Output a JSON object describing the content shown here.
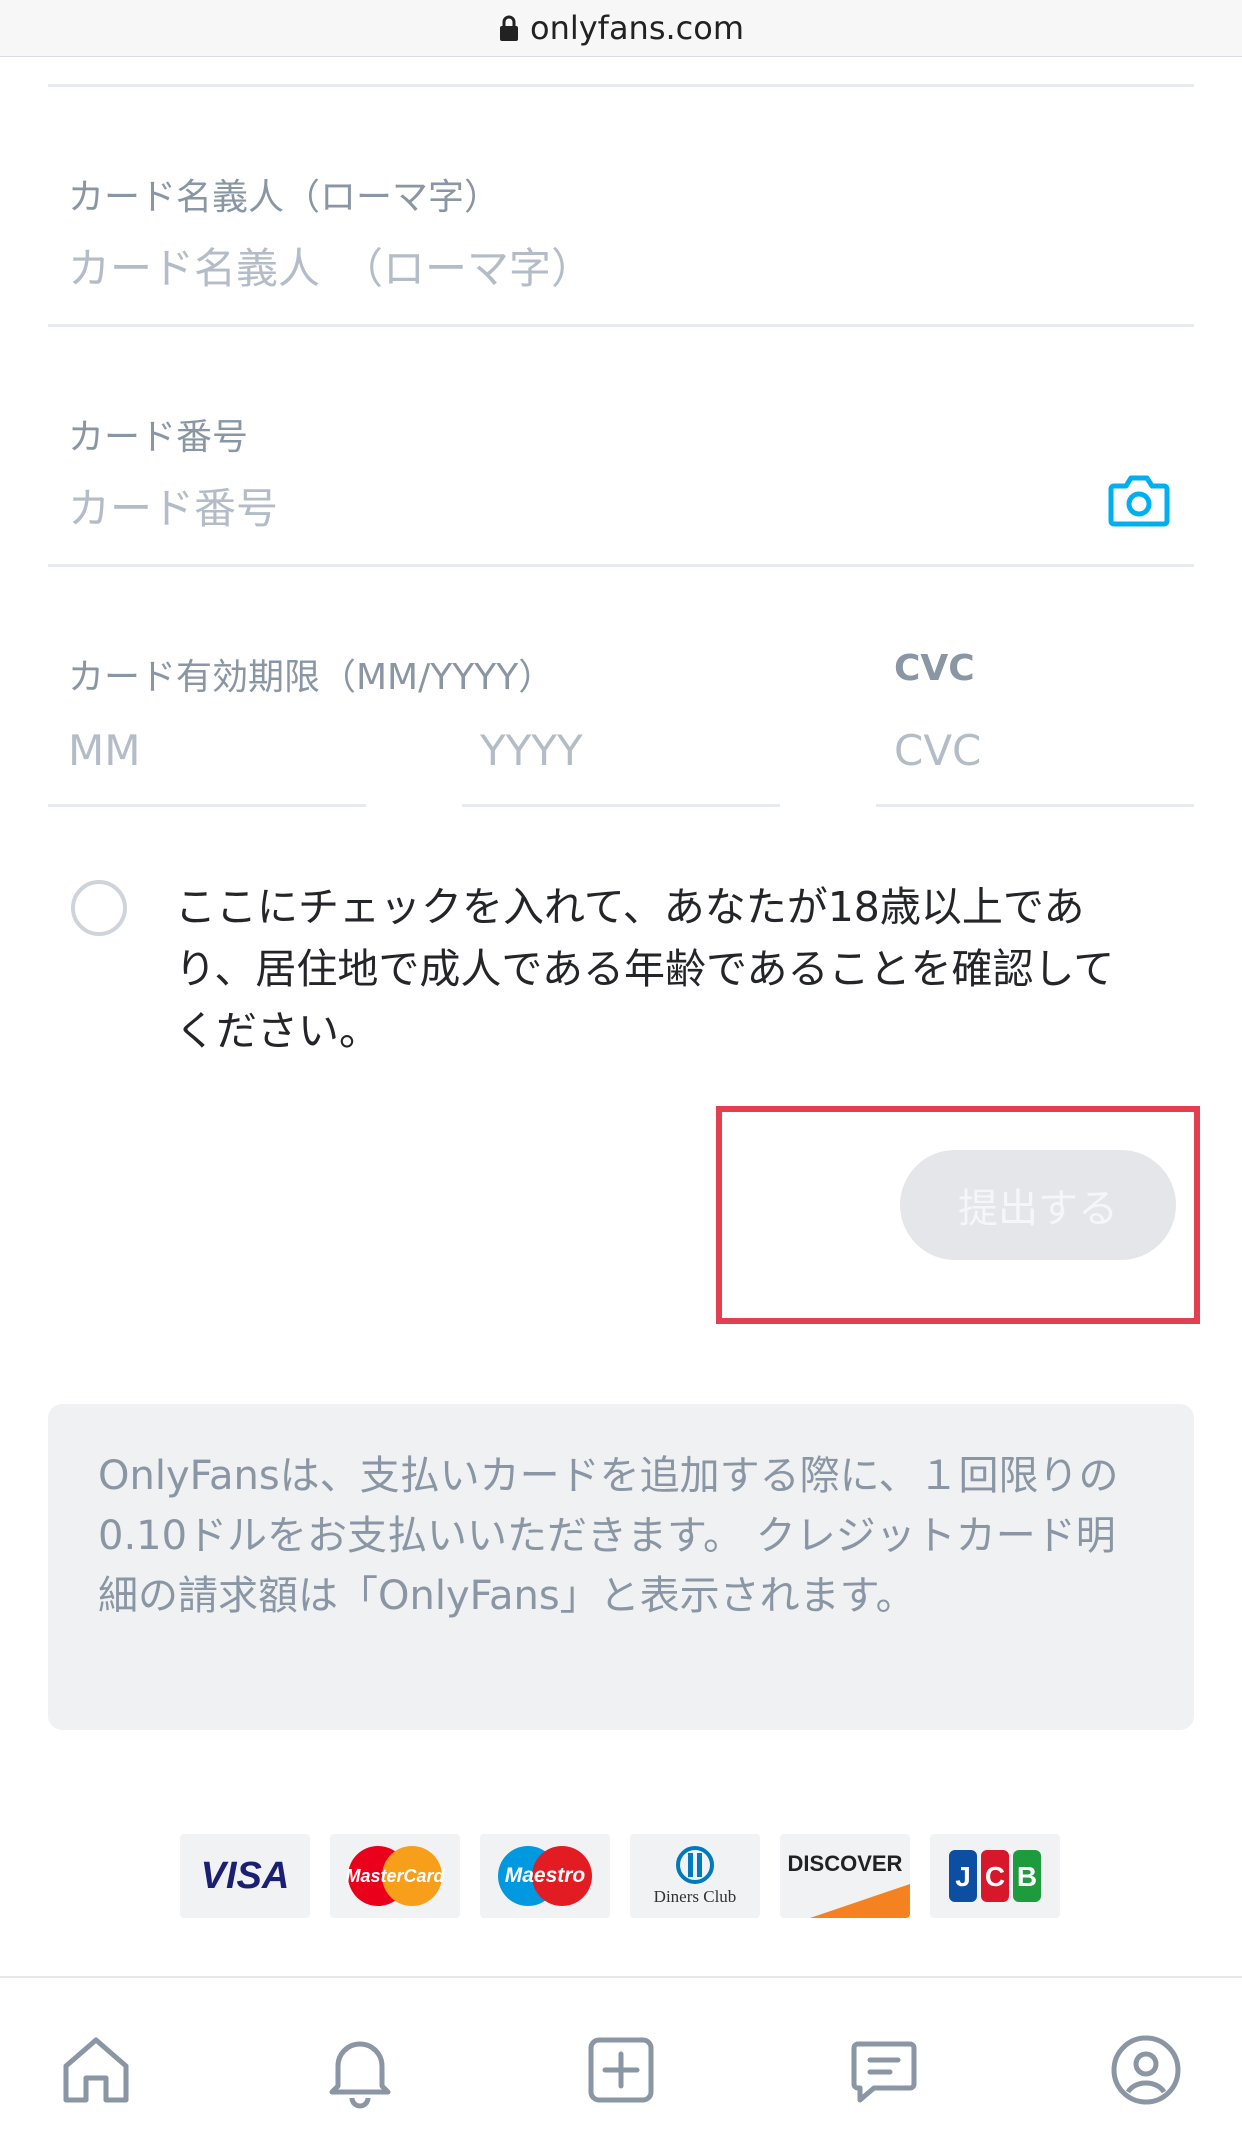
{
  "browser": {
    "url": "onlyfans.com"
  },
  "form": {
    "cardholder_label": "カード名義人（ローマ字）",
    "cardholder_placeholder": "カード名義人　（ローマ字）",
    "card_number_label": "カード番号",
    "card_number_placeholder": "カード番号",
    "expiry_label": "カード有効期限（MM/YYYY）",
    "expiry_month_placeholder": "MM",
    "expiry_year_placeholder": "YYYY",
    "cvc_label": "CVC",
    "cvc_placeholder": "CVC",
    "age_confirm_text": "ここにチェックを入れて、あなたが18歳以上であり、居住地で成人である年齢であることを確認してください。",
    "submit_label": "提出する"
  },
  "notice": {
    "text": "OnlyFansは、支払いカードを追加する際に、１回限りの0.10ドルをお支払いいただきます。 クレジットカード明細の請求額は「OnlyFans」と表示されます。"
  },
  "card_brands": {
    "visa": "VISA",
    "mastercard": "MasterCard",
    "maestro": "Maestro",
    "diners": "Diners Club",
    "discover": "DISCOVER",
    "jcb": "JCB"
  },
  "colors": {
    "accent": "#00aff0",
    "highlight": "#e24050",
    "disabled_button": "#e4e6ea"
  },
  "nav": {
    "icons": [
      "home-icon",
      "bell-icon",
      "plus-square-icon",
      "message-icon",
      "profile-icon"
    ]
  }
}
